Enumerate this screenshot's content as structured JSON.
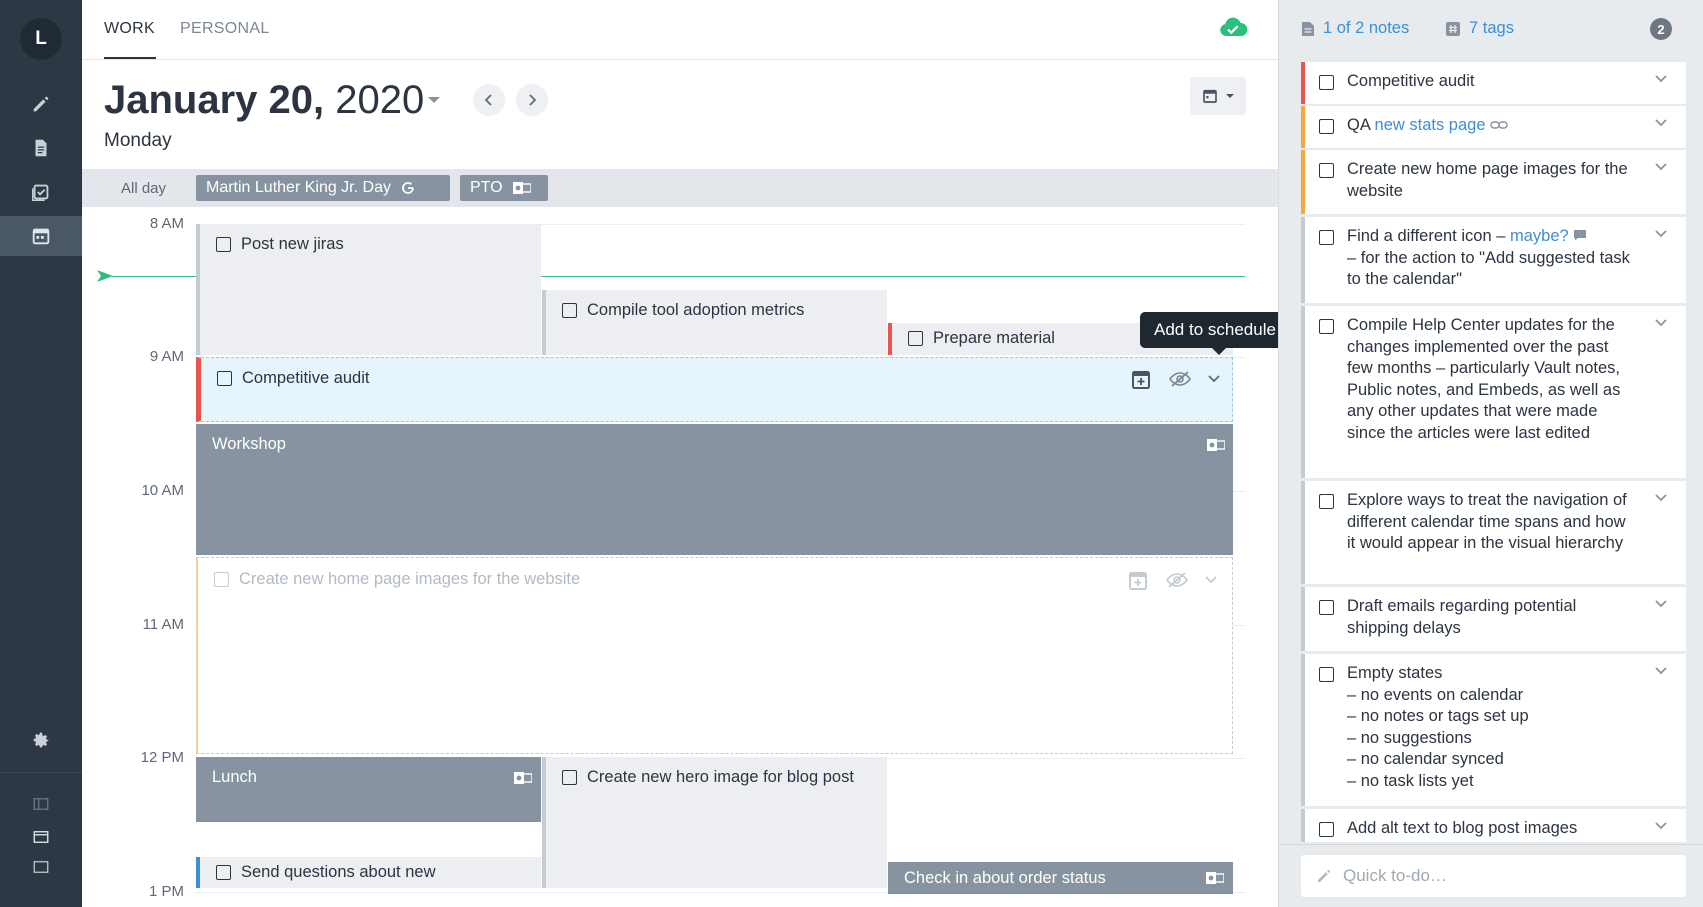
{
  "rail": {
    "avatar_initial": "L",
    "items": [
      {
        "name": "compose",
        "icon": "pencil-icon"
      },
      {
        "name": "notes",
        "icon": "document-icon"
      },
      {
        "name": "tasks",
        "icon": "checklist-icon"
      },
      {
        "name": "calendar",
        "icon": "calendar-icon",
        "active": true
      }
    ],
    "settings_icon": "gear-icon",
    "layout_icons": [
      "layout-split-icon",
      "layout-sidebar-icon",
      "layout-single-icon"
    ]
  },
  "tabs": {
    "work": "WORK",
    "personal": "PERSONAL",
    "sync_icon": "cloud-check-icon"
  },
  "header": {
    "date_bold": "January 20,",
    "year": "2020",
    "weekday": "Monday"
  },
  "allday": {
    "label": "All day",
    "events": [
      {
        "title": "Martin Luther King Jr. Day",
        "icon": "google-icon"
      },
      {
        "title": "PTO",
        "icon": "outlook-icon"
      }
    ]
  },
  "hours": [
    "8 AM",
    "9 AM",
    "10 AM",
    "11 AM",
    "12 PM",
    "1 PM"
  ],
  "events": {
    "post_jiras": "Post new jiras",
    "compile_tool": "Compile tool adoption metrics",
    "prepare_material": "Prepare material",
    "competitive_audit": "Competitive audit",
    "workshop": "Workshop",
    "home_page_images": "Create new home page images for the website",
    "lunch": "Lunch",
    "hero_image": "Create new hero image for blog post",
    "send_questions": "Send questions about new",
    "check_in": "Check in about order status"
  },
  "tooltip": "Add to schedule",
  "panel": {
    "notes_link": "1 of 2 notes",
    "tags_link": "7 tags",
    "count": "2",
    "quick_placeholder": "Quick to-do…",
    "items": [
      {
        "color": "red",
        "text": "Competitive audit"
      },
      {
        "color": "orange",
        "text_prefix": "QA ",
        "link": "new stats page"
      },
      {
        "color": "orange",
        "text": "Create new home page images for the website"
      },
      {
        "color": "gray",
        "text_prefix": "Find a different icon – ",
        "link": "maybe?",
        "text_suffix": "– for the action to \"Add suggested task to the calendar\""
      },
      {
        "color": "gray",
        "text": "Compile Help Center updates for the changes implemented over the past few months – particularly Vault notes, Public notes, and Embeds, as well as any other updates that were made since the articles were last edited"
      },
      {
        "color": "gray",
        "text": "Explore ways to treat the navigation of different calendar time spans and how it would appear in the visual hierarchy"
      },
      {
        "color": "gray",
        "text": "Draft emails regarding potential shipping delays"
      },
      {
        "color": "gray",
        "lines": [
          "Empty states",
          "– no events on calendar",
          "– no notes or tags set up",
          "– no suggestions",
          "– no calendar synced",
          "– no task lists yet"
        ]
      },
      {
        "color": "gray",
        "text": "Add alt text to blog post images"
      }
    ]
  }
}
